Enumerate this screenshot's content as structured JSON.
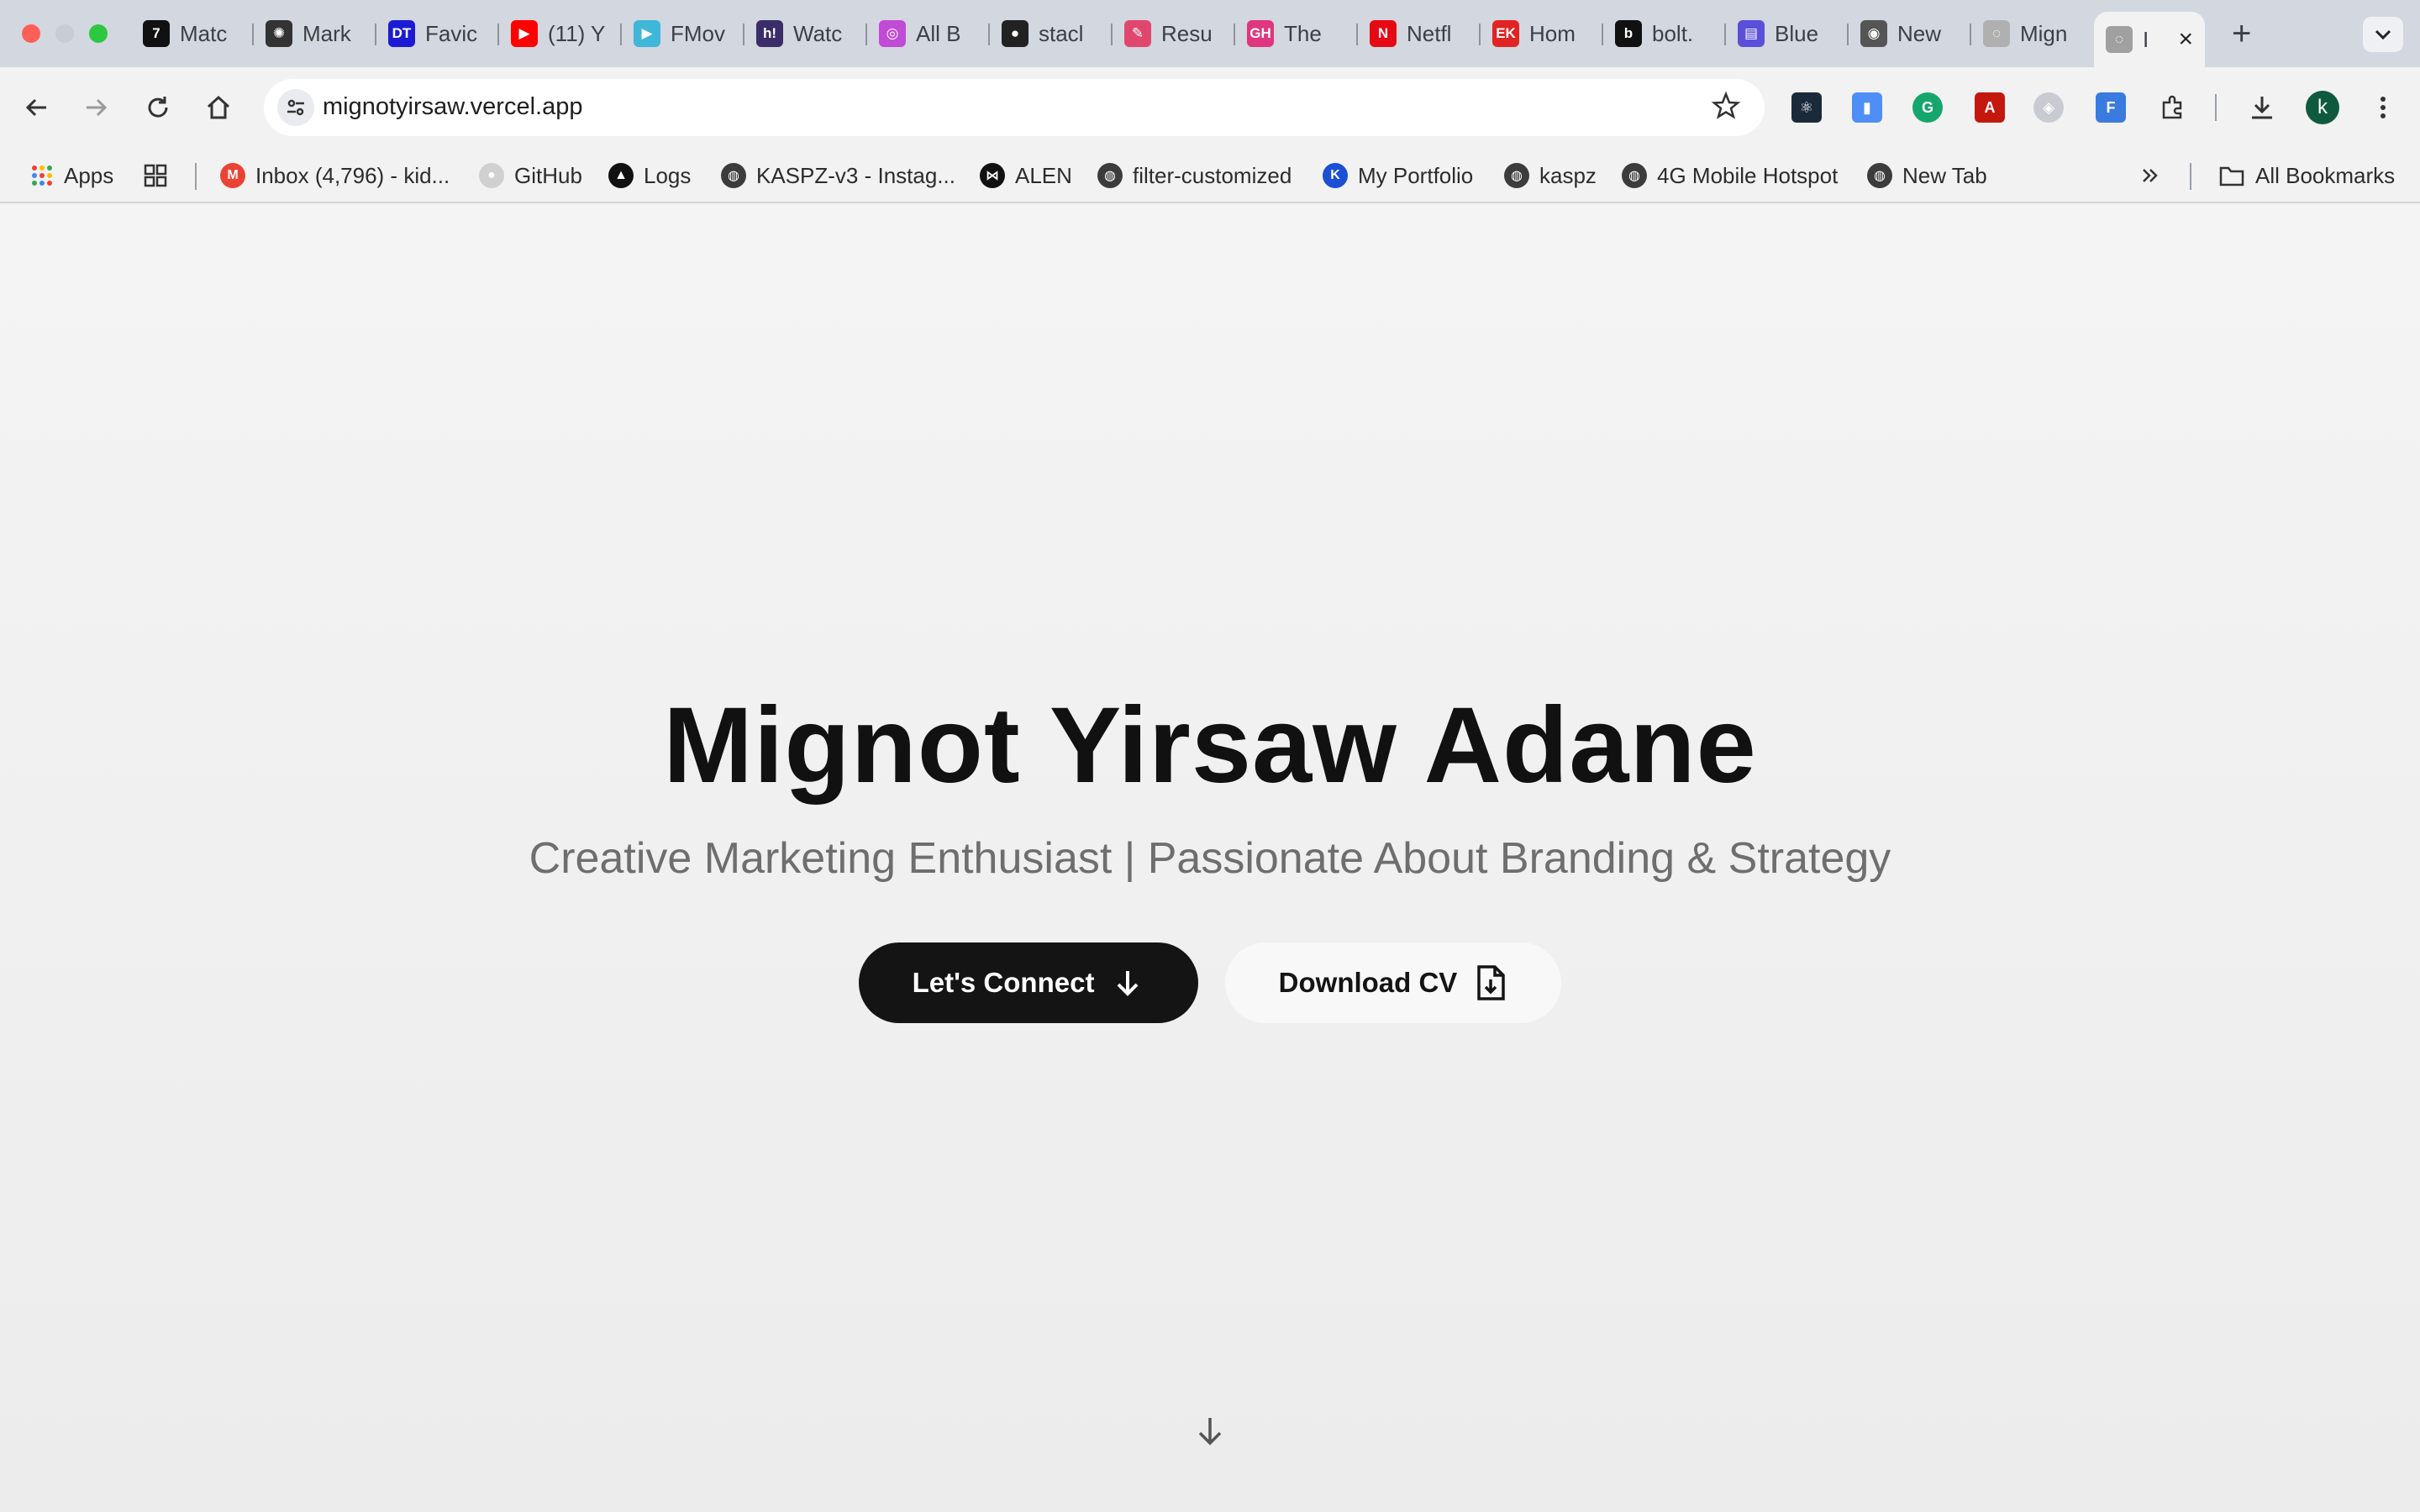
{
  "browser": {
    "tabs": [
      {
        "title": "Matc",
        "icon": "seven-icon",
        "color": "#111111",
        "glyph": "7"
      },
      {
        "title": "Mark",
        "icon": "openai-icon",
        "color": "#333333",
        "glyph": "✺"
      },
      {
        "title": "Favic",
        "icon": "dans-tools-icon",
        "color": "#1b1bd6",
        "glyph": "DT"
      },
      {
        "title": "(11) Y",
        "icon": "youtube-icon",
        "color": "#ff0000",
        "glyph": "▶"
      },
      {
        "title": "FMov",
        "icon": "fmovies-icon",
        "color": "#3fb7d8",
        "glyph": "▶"
      },
      {
        "title": "Watc",
        "icon": "h-icon",
        "color": "#3a2d6a",
        "glyph": "h!"
      },
      {
        "title": "All B",
        "icon": "arc-icon",
        "color": "#c04bd6",
        "glyph": "◎"
      },
      {
        "title": "stacl",
        "icon": "github-icon",
        "color": "#222222",
        "glyph": "●"
      },
      {
        "title": "Resu",
        "icon": "pen-icon",
        "color": "#e0476f",
        "glyph": "✎"
      },
      {
        "title": "The",
        "icon": "gh-icon",
        "color": "#e0367f",
        "glyph": "GH"
      },
      {
        "title": "Netfl",
        "icon": "netflix-icon",
        "color": "#e50914",
        "glyph": "N"
      },
      {
        "title": "Hom",
        "icon": "ek-icon",
        "color": "#e02424",
        "glyph": "EK"
      },
      {
        "title": "bolt.",
        "icon": "bolt-icon",
        "color": "#111111",
        "glyph": "b"
      },
      {
        "title": "Blue",
        "icon": "printer-icon",
        "color": "#5a4fd8",
        "glyph": "▤"
      },
      {
        "title": "New",
        "icon": "chrome-icon",
        "color": "#555555",
        "glyph": "◉"
      },
      {
        "title": "Mign",
        "icon": "globe-icon",
        "color": "#b0b0b0",
        "glyph": "◌"
      },
      {
        "title": "I",
        "icon": "globe-icon",
        "color": "#a0a0a0",
        "glyph": "◌"
      }
    ],
    "url": "mignotyirsaw.vercel.app",
    "profile_initial": "k",
    "bookmarks": {
      "apps": "Apps",
      "items": [
        {
          "label": "Inbox (4,796) - kid...",
          "icon": "gmail-icon"
        },
        {
          "label": "GitHub",
          "icon": "github-icon"
        },
        {
          "label": "Logs",
          "icon": "logs-icon"
        },
        {
          "label": "KASPZ-v3 - Instag...",
          "icon": "globe-icon"
        },
        {
          "label": "ALEN",
          "icon": "bowtie-icon"
        },
        {
          "label": "filter-customized",
          "icon": "globe-icon"
        },
        {
          "label": "My Portfolio",
          "icon": "k-icon"
        },
        {
          "label": "kaspz",
          "icon": "globe-icon"
        },
        {
          "label": "4G Mobile Hotspot",
          "icon": "globe-icon"
        },
        {
          "label": "New Tab",
          "icon": "globe-icon"
        }
      ],
      "all_bookmarks": "All Bookmarks"
    }
  },
  "hero": {
    "name": "Mignot Yirsaw Adane",
    "tagline": "Creative Marketing Enthusiast | Passionate About Branding & Strategy",
    "connect_label": "Let's Connect",
    "cv_label": "Download CV"
  },
  "colors": {
    "primary_button": "#141414",
    "page_bg": "#f2f2f2",
    "subtitle": "#6e6e6e"
  }
}
